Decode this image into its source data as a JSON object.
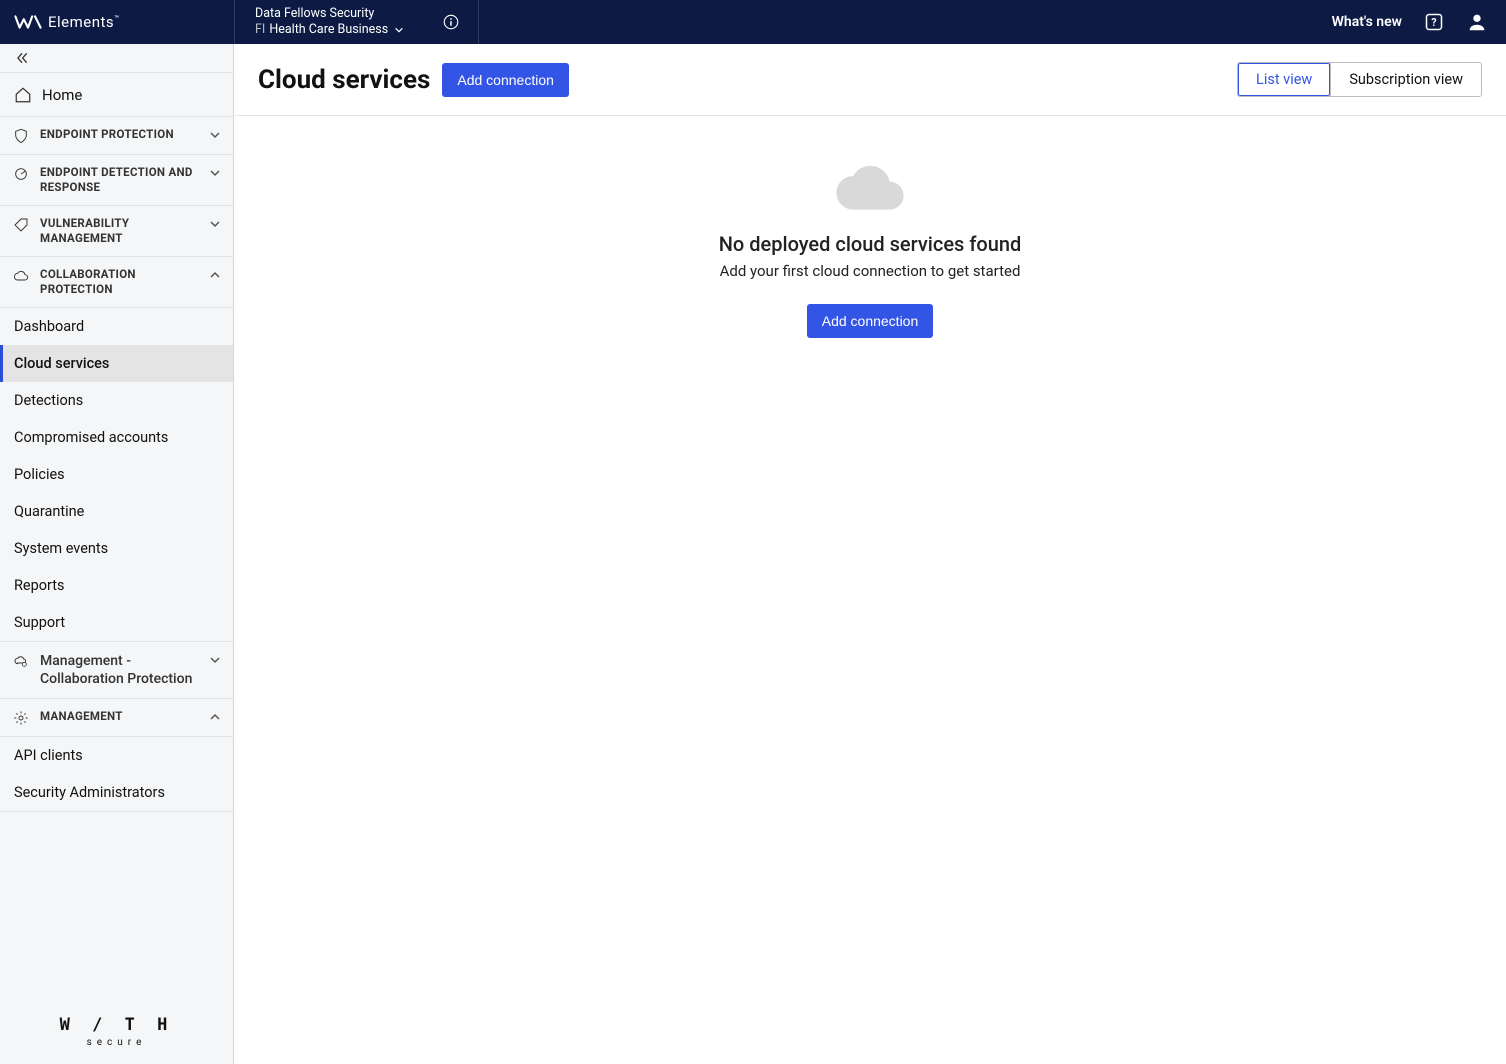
{
  "brand": {
    "name": "Elements",
    "tm": "™"
  },
  "org": {
    "line1": "Data Fellows Security",
    "prefix": "FI",
    "line2": "Health Care Business"
  },
  "header": {
    "whats_new": "What's new"
  },
  "sidebar": {
    "home": "Home",
    "sections": {
      "epp": "Endpoint Protection",
      "edr": "Endpoint Detection and Response",
      "vm": "Vulnerability Management",
      "cp": "Collaboration Protection",
      "mcp": "Management - Collaboration Protection",
      "mgmt": "Management"
    },
    "cp_items": [
      "Dashboard",
      "Cloud services",
      "Detections",
      "Compromised accounts",
      "Policies",
      "Quarantine",
      "System events",
      "Reports",
      "Support"
    ],
    "mgmt_items": [
      "API clients",
      "Security Administrators"
    ],
    "footer_brand": "W / T H",
    "footer_sub": "secure"
  },
  "page": {
    "title": "Cloud services",
    "add_connection": "Add connection",
    "view_list": "List view",
    "view_sub": "Subscription view",
    "empty_title": "No deployed cloud services found",
    "empty_sub": "Add your first cloud connection to get started",
    "empty_cta": "Add connection"
  }
}
